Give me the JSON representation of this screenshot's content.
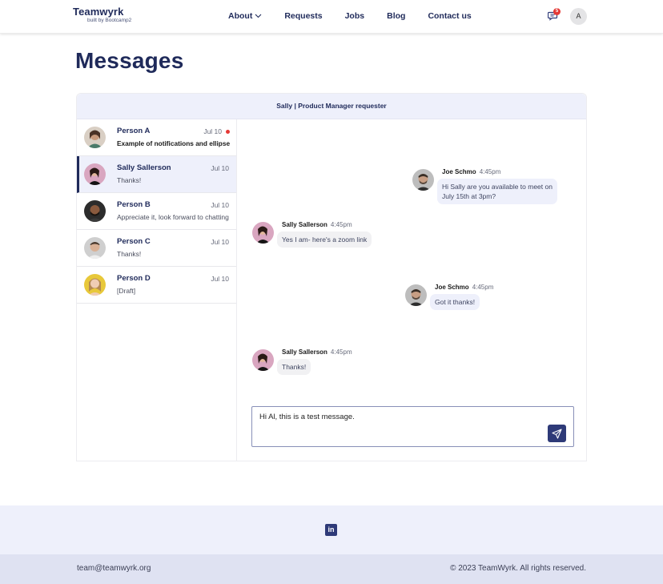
{
  "header": {
    "logo_title": "Teamwyrk",
    "logo_subtitle": "built by Bootcamp2",
    "nav": [
      {
        "label": "About",
        "has_dropdown": true
      },
      {
        "label": "Requests"
      },
      {
        "label": "Jobs"
      },
      {
        "label": "Blog"
      },
      {
        "label": "Contact us"
      }
    ],
    "notifications": {
      "icon": "message-notification-icon",
      "count": "5"
    },
    "user_avatar_initial": "A"
  },
  "page": {
    "title": "Messages"
  },
  "conversation_header": "Sally | Product Manager requester",
  "conversations": [
    {
      "name": "Person A",
      "date": "Jul 10",
      "preview": "Example of notifications and ellipse",
      "unread": true,
      "active": false
    },
    {
      "name": "Sally Sallerson",
      "date": "Jul 10",
      "preview": "Thanks!",
      "unread": false,
      "active": true
    },
    {
      "name": "Person B",
      "date": "Jul 10",
      "preview": "Appreciate it, look forward to chatting",
      "unread": false,
      "active": false
    },
    {
      "name": "Person C",
      "date": "Jul 10",
      "preview": "Thanks!",
      "unread": false,
      "active": false
    },
    {
      "name": "Person D",
      "date": "Jul 10",
      "preview": "[Draft]",
      "unread": false,
      "active": false
    }
  ],
  "messages": [
    {
      "sender": "Joe Schmo",
      "time": "4:45pm",
      "text_lines": [
        "Hi Sally are you available to meet on",
        "July 15th at 3pm?"
      ],
      "side": "right"
    },
    {
      "sender": "Sally Sallerson",
      "time": "4:45pm",
      "text_lines": [
        "Yes I am- here's a zoom link"
      ],
      "side": "left"
    },
    {
      "sender": "Joe Schmo",
      "time": "4:45pm",
      "text_lines": [
        "Got it thanks!"
      ],
      "side": "right"
    },
    {
      "sender": "Sally Sallerson",
      "time": "4:45pm",
      "text_lines": [
        "Thanks!"
      ],
      "side": "left"
    }
  ],
  "composer": {
    "value": "Hi Al, this is a test message.",
    "send_icon": "send-icon"
  },
  "footer": {
    "social_icon": "linkedin-icon",
    "linkedin_label": "in",
    "email": "team@teamwyrk.org",
    "copyright": "© 2023 TeamWyrk. All rights reserved."
  },
  "colors": {
    "brand_navy": "#1f2a5a",
    "accent_button": "#2e3a78",
    "panel_tint": "#eef0fb",
    "unread_dot": "#e53935"
  }
}
